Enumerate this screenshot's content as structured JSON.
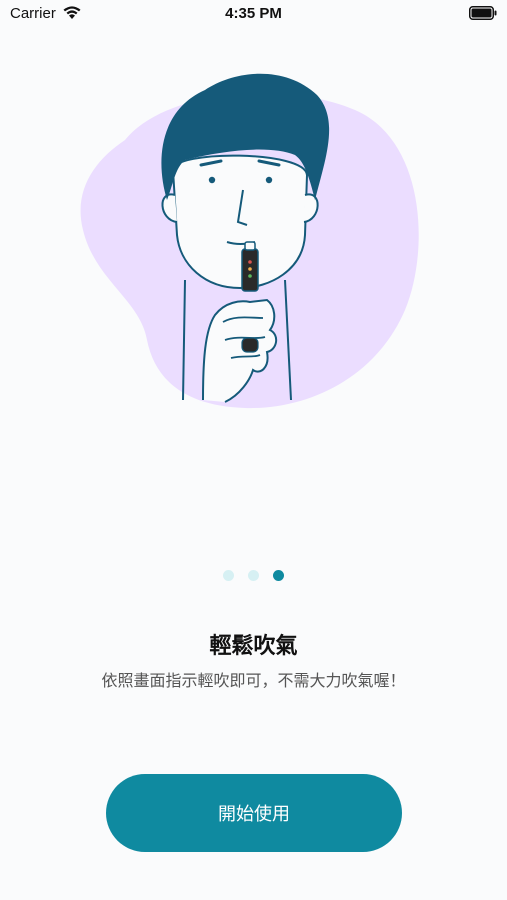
{
  "status_bar": {
    "carrier": "Carrier",
    "time": "4:35 PM",
    "icons": [
      "wifi-icon",
      "battery-icon"
    ]
  },
  "illustration": {
    "icon": "breathalyzer-blowing-illustration",
    "colors": {
      "blob": "#ebddff",
      "line": "#155a7a",
      "hair": "#155a7a"
    }
  },
  "pager": {
    "total": 3,
    "active_index": 2,
    "colors": {
      "active": "#0f8aa0",
      "inactive": "#d6f0f3"
    }
  },
  "content": {
    "title": "輕鬆吹氣",
    "subtitle": "依照畫面指示輕吹即可，不需大力吹氣喔！"
  },
  "start_button": {
    "label": "開始使用",
    "color": "#0f8aa0"
  }
}
